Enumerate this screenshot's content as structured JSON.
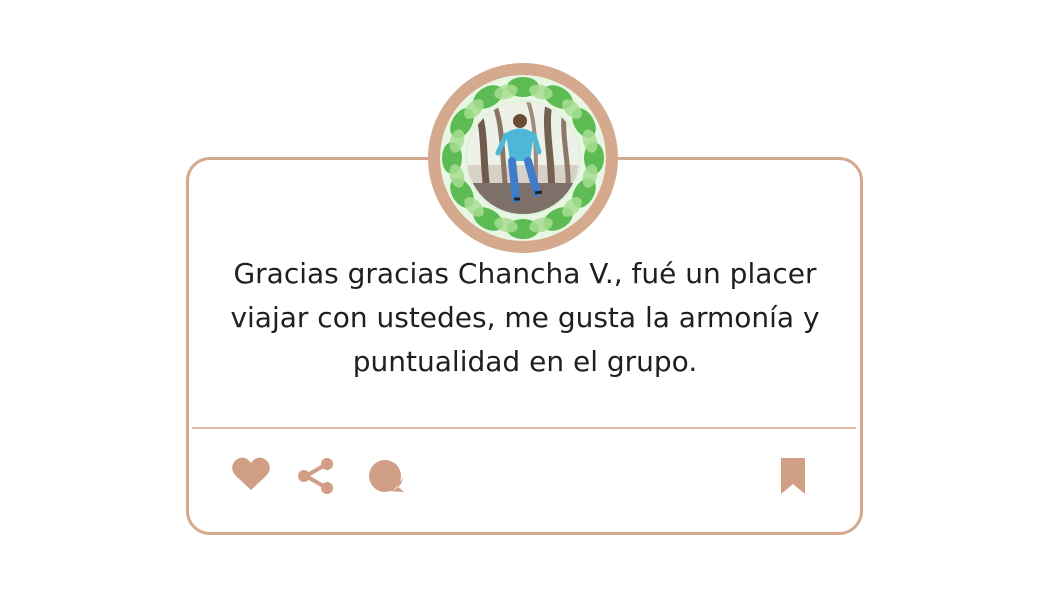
{
  "review": {
    "text": "Gracias gracias Chancha V., fué un placer viajar con ustedes, me gusta la armonía y puntualidad en el grupo."
  },
  "actions": {
    "like_icon": "heart-icon",
    "share_icon": "share-icon",
    "comment_icon": "comment-icon",
    "save_icon": "bookmark-icon"
  },
  "colors": {
    "accent": "#d4a98e",
    "icon": "#d09f85",
    "leaf": "#57b34f",
    "text": "#1f1f1f"
  }
}
